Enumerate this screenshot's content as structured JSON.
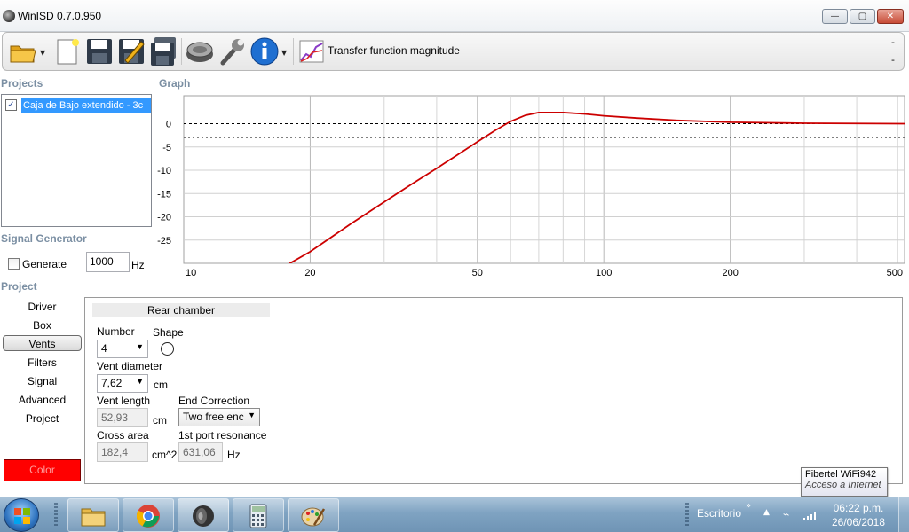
{
  "window": {
    "title": "WinISD 0.7.0.950",
    "buttons": {
      "minimize": "—",
      "maximize": "▢",
      "close": "✕"
    }
  },
  "toolbar": {
    "icons": [
      "folder-open-icon",
      "new-document-icon",
      "save-icon",
      "save-as-icon",
      "save-all-icon",
      "driver-speaker-icon",
      "wrench-icon",
      "info-icon",
      "graph-icon"
    ],
    "graph_type_label": "Transfer function magnitude",
    "dash_top": "-",
    "dash_bottom": "-"
  },
  "sections": {
    "projects": "Projects",
    "graph": "Graph",
    "signal_generator": "Signal Generator",
    "project": "Project"
  },
  "projects": {
    "items": [
      {
        "checked": true,
        "label": "Caja de Bajo extendido - 3c"
      }
    ]
  },
  "signal_generator": {
    "generate_label": "Generate",
    "generate_checked": false,
    "frequency_value": "1000",
    "unit": "Hz"
  },
  "chart_data": {
    "type": "line",
    "xscale": "log",
    "xlim": [
      10,
      520
    ],
    "ylim": [
      -30,
      6
    ],
    "x_ticks": [
      "10",
      "20",
      "50",
      "100",
      "200",
      "500"
    ],
    "y_ticks": [
      "0",
      "-5",
      "-10",
      "-15",
      "-20",
      "-25"
    ],
    "reference_lines": [
      0,
      -3
    ],
    "series": [
      {
        "color": "#cc0000",
        "x": [
          17.5,
          20,
          25,
          30,
          35,
          40,
          45,
          50,
          55,
          60,
          65,
          70,
          80,
          90,
          100,
          120,
          150,
          200,
          300,
          520
        ],
        "y": [
          -30.5,
          -27.5,
          -21.5,
          -16.8,
          -12.9,
          -9.6,
          -6.6,
          -3.9,
          -1.5,
          0.5,
          1.8,
          2.4,
          2.4,
          2.1,
          1.7,
          1.2,
          0.7,
          0.3,
          0.1,
          0.0
        ]
      }
    ],
    "grid": true
  },
  "project_nav": {
    "items": [
      "Driver",
      "Box",
      "Vents",
      "Filters",
      "Signal",
      "Advanced",
      "Project"
    ],
    "active": "Vents",
    "color_button": "Color",
    "color": "#ff0000"
  },
  "vents": {
    "header": "Rear chamber",
    "number_label": "Number",
    "number_value": "4",
    "shape_label": "Shape",
    "diameter_label": "Vent diameter",
    "diameter_value": "7,62",
    "diameter_unit": "cm",
    "length_label": "Vent length",
    "length_value": "52,93",
    "length_unit": "cm",
    "end_correction_label": "End Correction",
    "end_correction_value": "Two free enc",
    "cross_area_label": "Cross area",
    "cross_area_value": "182,4",
    "cross_area_unit": "cm^2",
    "port_resonance_label": "1st port resonance",
    "port_resonance_value": "631,06",
    "port_resonance_unit": "Hz"
  },
  "tooltip": {
    "network": "Fibertel WiFi942",
    "status": "Acceso a Internet"
  },
  "taskbar": {
    "apps": [
      "file-explorer-icon",
      "chrome-icon",
      "winisd-speaker-icon",
      "calculator-icon",
      "paint-icon"
    ],
    "desktop_label": "Escritorio",
    "time": "06:22 p.m.",
    "date": "26/06/2018"
  }
}
